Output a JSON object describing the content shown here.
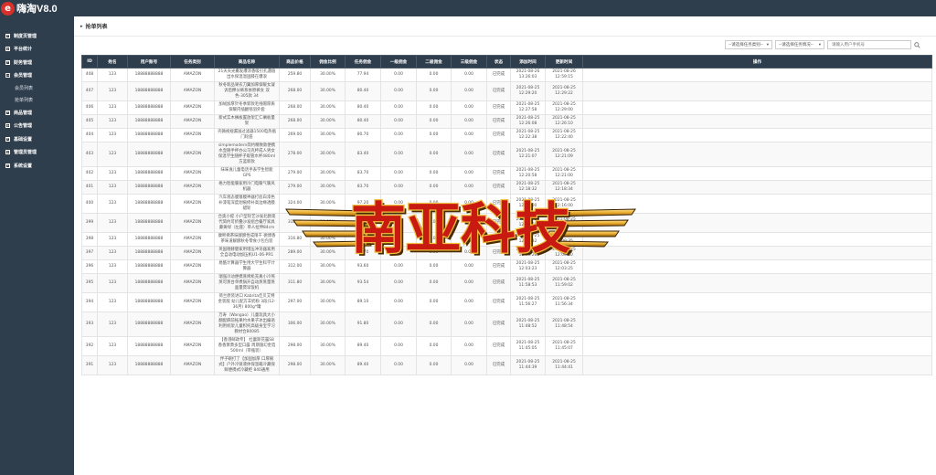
{
  "app": {
    "logo_letter": "e",
    "title": "嗨淘V8.0"
  },
  "sidebar": {
    "items": [
      {
        "label": "制度页管理",
        "open": false
      },
      {
        "label": "平台统计",
        "open": false
      },
      {
        "label": "财务管理",
        "open": false
      },
      {
        "label": "会员管理",
        "open": true
      },
      {
        "label": "商品管理",
        "open": false
      },
      {
        "label": "公告管理",
        "open": false
      },
      {
        "label": "基础设置",
        "open": false
      },
      {
        "label": "管理员管理",
        "open": false
      },
      {
        "label": "系统设置",
        "open": false
      }
    ],
    "subitems": [
      "会员列表",
      "抢单列表"
    ]
  },
  "page": {
    "title": "抢单列表"
  },
  "filters": {
    "task_type_placeholder": "--请选择任务类别--",
    "task_status_placeholder": "--请选择任务情况--",
    "search_placeholder": "请输入用户手机号"
  },
  "table": {
    "headers": [
      "ID",
      "姓名",
      "用户账号",
      "任务类别",
      "商品名称",
      "商品价格",
      "佣金比例",
      "任务佣金",
      "一级佣金",
      "二级佣金",
      "三级佣金",
      "状态",
      "添加时间",
      "更新时间",
      "操作"
    ],
    "rows": [
      [
        "408",
        "123",
        "18888888888",
        "AMAZON",
        "21天天光撒发爆浓香吸引孔遇值出水探温温固膝在爆浪",
        "259.80",
        "30.00%",
        "77.94",
        "0.00",
        "0.00",
        "0.00",
        "已完成",
        "2021-08-26 13:26:03",
        "2021-08-26 12:59:15"
      ],
      [
        "407",
        "123",
        "18888888888",
        "AMAZON",
        "秋冬新品果农刀翼加厚保暖女凝诉后穆分裤系依原裤女 双色-305款 34",
        "268.00",
        "30.00%",
        "80.40",
        "0.00",
        "0.00",
        "0.00",
        "已完成",
        "2021-08-25 12:29:20",
        "2021-08-25 12:29:22"
      ],
      [
        "406",
        "123",
        "18888888888",
        "AMAZON",
        "加绒加厚针冬季新款毛线帽厚质保暖内插翻毯羽外套",
        "268.00",
        "30.00%",
        "80.40",
        "0.00",
        "0.00",
        "0.00",
        "已完成",
        "2021-08-25 12:27:58",
        "2021-08-25 12:29:00"
      ],
      [
        "405",
        "123",
        "18888888888",
        "AMAZON",
        "新式实木搁板置放架汇仁搁板量架",
        "268.00",
        "30.00%",
        "80.40",
        "0.00",
        "0.00",
        "0.00",
        "已完成",
        "2021-08-25 12:26:08",
        "2021-08-25 12:26:10"
      ],
      [
        "404",
        "123",
        "18888888888",
        "AMAZON",
        "壳微视规漏滋过滤器1500电热瓶门轮座",
        "269.00",
        "30.00%",
        "80.70",
        "0.00",
        "0.00",
        "0.00",
        "已完成",
        "2021-08-25 12:22:38",
        "2021-08-25 12:22:40"
      ],
      [
        "403",
        "123",
        "18888888888",
        "AMAZON",
        "simplemodern简约精致款便携水壶随手杯办公马克杯成人男女保温学生随杯子吸管水杯480ml 方蓝新款",
        "278.00",
        "30.00%",
        "83.40",
        "0.00",
        "0.00",
        "0.00",
        "已完成",
        "2021-08-25 12:21:07",
        "2021-08-25 12:21:09"
      ],
      [
        "402",
        "123",
        "18888888888",
        "AMAZON",
        "味味逸儿童电话手表学生智能GPS",
        "279.00",
        "30.00%",
        "83.70",
        "0.00",
        "0.00",
        "0.00",
        "已完成",
        "2021-08-25 12:20:58",
        "2021-08-25 12:21:00"
      ],
      [
        "401",
        "123",
        "18888888888",
        "AMAZON",
        "格力智能暖家用冷门电暖气暖风机器",
        "279.00",
        "30.00%",
        "83.70",
        "0.00",
        "0.00",
        "0.00",
        "已完成",
        "2021-08-25 12:18:32",
        "2021-08-25 12:18:34"
      ],
      [
        "400",
        "123",
        "18888888888",
        "AMAZON",
        "汽车液态膜镀膜神器打底白漆色补漆笔深度划痕修补高边缘透膜蜡轮",
        "324.00",
        "30.00%",
        "97.20",
        "0.00",
        "0.00",
        "0.00",
        "已完成",
        "2021-08-25 12:16:00",
        "2021-08-25 12:16:00"
      ],
      [
        "399",
        "123",
        "18888888888",
        "AMAZON",
        "合奥小提 小户型轮艺沙发北欧现代简约可折叠沙发组合餐厅家具 藤黄绿（左座）单人拉伸84cm",
        "318.00",
        "30.00%",
        "95.40",
        "0.00",
        "0.00",
        "0.00",
        "已完成",
        "2021-08-25 12:09:58",
        "2021-08-25 12:10:01"
      ],
      [
        "398",
        "123",
        "18888888888",
        "AMAZON",
        "康熙佛茶味酵酵性成限干 德博香茶味道解酵秋冬零食小包包装",
        "316.80",
        "30.00%",
        "95.04",
        "0.00",
        "0.00",
        "0.00",
        "已完成",
        "2021-08-25 12:09:32",
        "2021-08-25 12:09:35"
      ],
      [
        "397",
        "123",
        "18888888888",
        "AMAZON",
        "英国德赫健家用增压冲牙器家用全自动电动加压机U1-06-PR1",
        "289.00",
        "30.00%",
        "86.70",
        "0.00",
        "0.00",
        "0.00",
        "已完成",
        "2021-08-25 12:06:28",
        "2021-08-25 12:06:30"
      ],
      [
        "396",
        "123",
        "18888888888",
        "AMAZON",
        "易酷计算器学生用大学生科学计算器",
        "312.00",
        "30.00%",
        "93.60",
        "0.00",
        "0.00",
        "0.00",
        "已完成",
        "2021-08-25 12:03:23",
        "2021-08-25 12:03:25"
      ],
      [
        "395",
        "123",
        "18888888888",
        "AMAZON",
        "瑞强冷动便携蒸烤机充真小冷燕蒸可蒸台单煮锅开自动蒸蒸量蒸面量煲早饭机",
        "311.80",
        "30.00%",
        "93.54",
        "0.00",
        "0.00",
        "0.00",
        "已完成",
        "2021-08-25 11:58:53",
        "2021-08-25 11:59:02"
      ],
      [
        "394",
        "123",
        "18888888888",
        "AMAZON",
        "荷兰原装进口 Kabrita佳贝艾特 金装版 幼儿配方羊奶粉 3段(12-36月) 800g*罐",
        "297.00",
        "30.00%",
        "89.10",
        "0.00",
        "0.00",
        "0.00",
        "已完成",
        "2021-08-25 11:56:27",
        "2021-08-25 11:56:34"
      ],
      [
        "393",
        "123",
        "18888888888",
        "AMAZON",
        "万寿（Wangao）儿童玩具大小翻配麻前拓果约水果子冰出编语利用机架儿童积托高级身宝学习教材合B0085",
        "306.00",
        "30.00%",
        "91.80",
        "0.00",
        "0.00",
        "0.00",
        "已完成",
        "2021-08-25 11:48:52",
        "2021-08-25 11:48:54"
      ],
      [
        "392",
        "123",
        "18888888888",
        "AMAZON",
        "【香港邮政专】 杜蕾斯花露S8香香萧萧多型口露 周期施幻金箔500ml（带瓶装）",
        "298.00",
        "30.00%",
        "89.40",
        "0.00",
        "0.00",
        "0.00",
        "已完成",
        "2021-08-25 11:45:05",
        "2021-08-25 11:45:07"
      ],
      [
        "391",
        "123",
        "18888888888",
        "AMAZON",
        "伴子碗打了【加固加厚 口厚碗式】户外冷链液体保温箱冷藏保鲜便携式冷藏柜 840通用",
        "298.00",
        "30.00%",
        "89.40",
        "0.00",
        "0.00",
        "0.00",
        "已完成",
        "2021-08-25 11:44:39",
        "2021-08-25 11:44:41"
      ]
    ]
  },
  "watermark": {
    "text": "南亚科技"
  },
  "colors": {
    "sidebar_bg": "#2f3e4d",
    "logo_red": "#d9302c",
    "watermark_red": "#c91a12",
    "watermark_gold": "#e9a92a"
  }
}
